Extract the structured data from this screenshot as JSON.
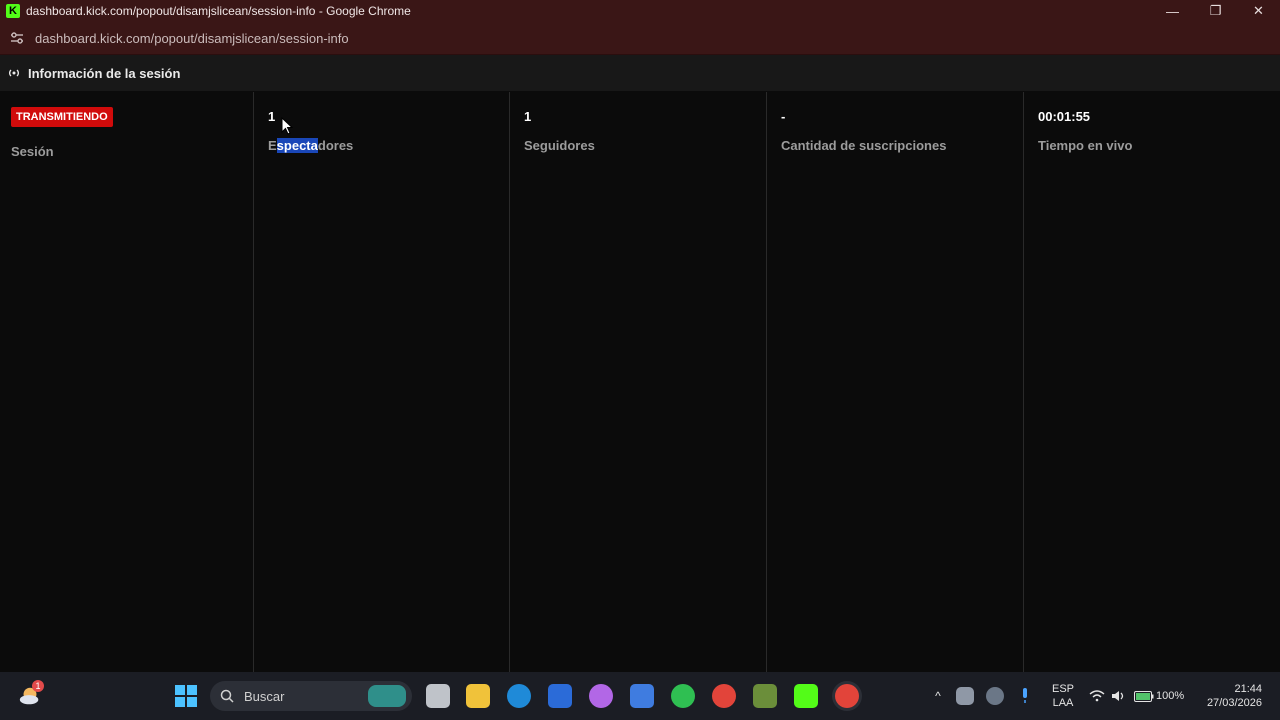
{
  "window": {
    "title": "dashboard.kick.com/popout/disamjslicean/session-info - Google Chrome",
    "logo_letter": "K",
    "minimize": "—",
    "restore": "❐",
    "close": "✕"
  },
  "urlbar": {
    "url": "dashboard.kick.com/popout/disamjslicean/session-info"
  },
  "header": {
    "title": "Información de la sesión"
  },
  "session": {
    "status": "TRANSMITIENDO",
    "label": "Sesión"
  },
  "stats": {
    "viewers": {
      "value": "1",
      "label_pre": "E",
      "label_sel": "specta",
      "label_post": "dores"
    },
    "followers": {
      "value": "1",
      "label": "Seguidores"
    },
    "subscriptions": {
      "value": "-",
      "label": "Cantidad de suscripciones"
    },
    "live_time": {
      "value": "00:01:55",
      "label": "Tiempo en vivo"
    }
  },
  "taskbar": {
    "search_label": "Buscar",
    "lang_top": "ESP",
    "lang_bottom": "LAA",
    "battery": "100%",
    "time": "21:44",
    "date": "27/03/2026",
    "weather_badge": "1"
  },
  "colors": {
    "accent_green": "#53fc18",
    "badge_red": "#d10b0b",
    "selection_blue": "#1a47b8"
  }
}
